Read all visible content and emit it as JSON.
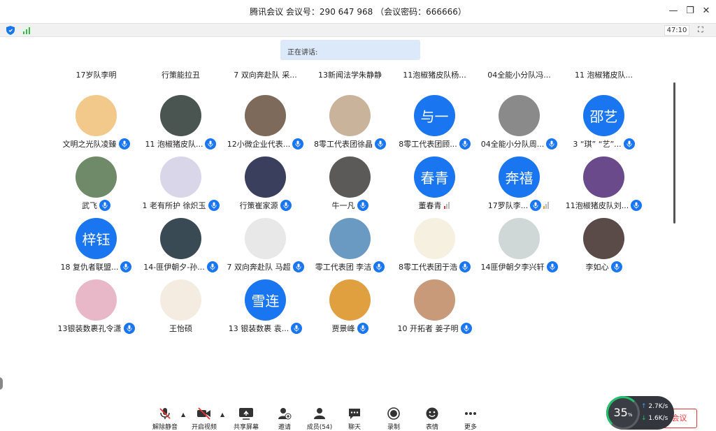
{
  "window": {
    "title": "腾讯会议 会议号：290 647 968 （会议密码：666666）",
    "timer": "47:10"
  },
  "speaking_label": "正在讲话:",
  "partial_row": [
    "17岁队李明",
    "行策能拉丑",
    "7 双向奔赴队 采...",
    "13新闻法学朱静静",
    "11泡椒猪皮队杨...",
    "04全能小分队冯...",
    "11 泡椒猪皮队..."
  ],
  "participants": [
    {
      "name": "文明之光队凌臻",
      "avatar_text": "",
      "avatar_color": "#f2c98a",
      "mic": "on"
    },
    {
      "name": "11  泡椒猪皮队...",
      "avatar_text": "",
      "avatar_color": "#4a5552",
      "mic": "on"
    },
    {
      "name": "12小微企业代表...",
      "avatar_text": "",
      "avatar_color": "#7d6a5a",
      "mic": "on"
    },
    {
      "name": "8零工代表团徐晶",
      "avatar_text": "",
      "avatar_color": "#c9b39a",
      "mic": "on"
    },
    {
      "name": "8零工代表团顾...",
      "avatar_text": "与一",
      "avatar_color": "#1a75f0",
      "mic": "on"
    },
    {
      "name": "04全能小分队周...",
      "avatar_text": "",
      "avatar_color": "#8a8a8a",
      "mic": "on"
    },
    {
      "name": "3  “琪”  “艺”...",
      "avatar_text": "邵艺",
      "avatar_color": "#1a75f0",
      "mic": "on"
    },
    {
      "name": "武飞",
      "avatar_text": "",
      "avatar_color": "#6f8a68",
      "mic": "on"
    },
    {
      "name": "1 老有所护 徐炽玉",
      "avatar_text": "",
      "avatar_color": "#d9d6ea",
      "mic": "on"
    },
    {
      "name": "行策崔家源",
      "avatar_text": "",
      "avatar_color": "#3b3f5e",
      "mic": "on"
    },
    {
      "name": "牛一凡",
      "avatar_text": "",
      "avatar_color": "#5c5a58",
      "mic": "on"
    },
    {
      "name": "董春青",
      "avatar_text": "春青",
      "avatar_color": "#1a75f0",
      "mic": "vol-red"
    },
    {
      "name": "17罗队李...",
      "avatar_text": "奔禧",
      "avatar_color": "#1a75f0",
      "mic": "on-vol-orange"
    },
    {
      "name": "11泡椒猪皮队刘...",
      "avatar_text": "",
      "avatar_color": "#6a4a8a",
      "mic": "on"
    },
    {
      "name": "18 复仇者联盟...",
      "avatar_text": "梓钰",
      "avatar_color": "#1a75f0",
      "mic": "on"
    },
    {
      "name": "14-匪伊朝夕-孙...",
      "avatar_text": "",
      "avatar_color": "#3a4a55",
      "mic": "on"
    },
    {
      "name": "7 双向奔赴队 马超",
      "avatar_text": "",
      "avatar_color": "#e8e8e8",
      "mic": "on"
    },
    {
      "name": "零工代表团 李洁",
      "avatar_text": "",
      "avatar_color": "#6a9ac2",
      "mic": "on"
    },
    {
      "name": "8零工代表团于浩",
      "avatar_text": "",
      "avatar_color": "#f5f0e0",
      "mic": "on"
    },
    {
      "name": "14匪伊朝夕李兴轩",
      "avatar_text": "",
      "avatar_color": "#cfd8d6",
      "mic": "on"
    },
    {
      "name": "李如心",
      "avatar_text": "",
      "avatar_color": "#5a4a48",
      "mic": "on"
    },
    {
      "name": "13银装数裹孔令潇",
      "avatar_text": "",
      "avatar_color": "#e8b8c8",
      "mic": "on"
    },
    {
      "name": "王怡硕",
      "avatar_text": "",
      "avatar_color": "#f4ece0",
      "mic": "none"
    },
    {
      "name": "13 银装数裹 袁...",
      "avatar_text": "雪连",
      "avatar_color": "#1a75f0",
      "mic": "on"
    },
    {
      "name": "贾景峰",
      "avatar_text": "",
      "avatar_color": "#e0a040",
      "mic": "on"
    },
    {
      "name": "10 开拓者 姜子明",
      "avatar_text": "",
      "avatar_color": "#c89a7a",
      "mic": "on"
    }
  ],
  "toolbar": {
    "unmute": "解除静音",
    "video": "开启视频",
    "share": "共享屏幕",
    "invite": "邀请",
    "members": "成员(54)",
    "chat": "聊天",
    "record": "录制",
    "reaction": "表情",
    "more": "更多",
    "end": "开会议"
  },
  "network": {
    "percent": "35",
    "percent_unit": "%",
    "up": "2.7K/s",
    "down": "1.6K/s"
  },
  "colors": {
    "accent": "#1a75f0",
    "danger": "#e33333",
    "good": "#22c16a"
  }
}
